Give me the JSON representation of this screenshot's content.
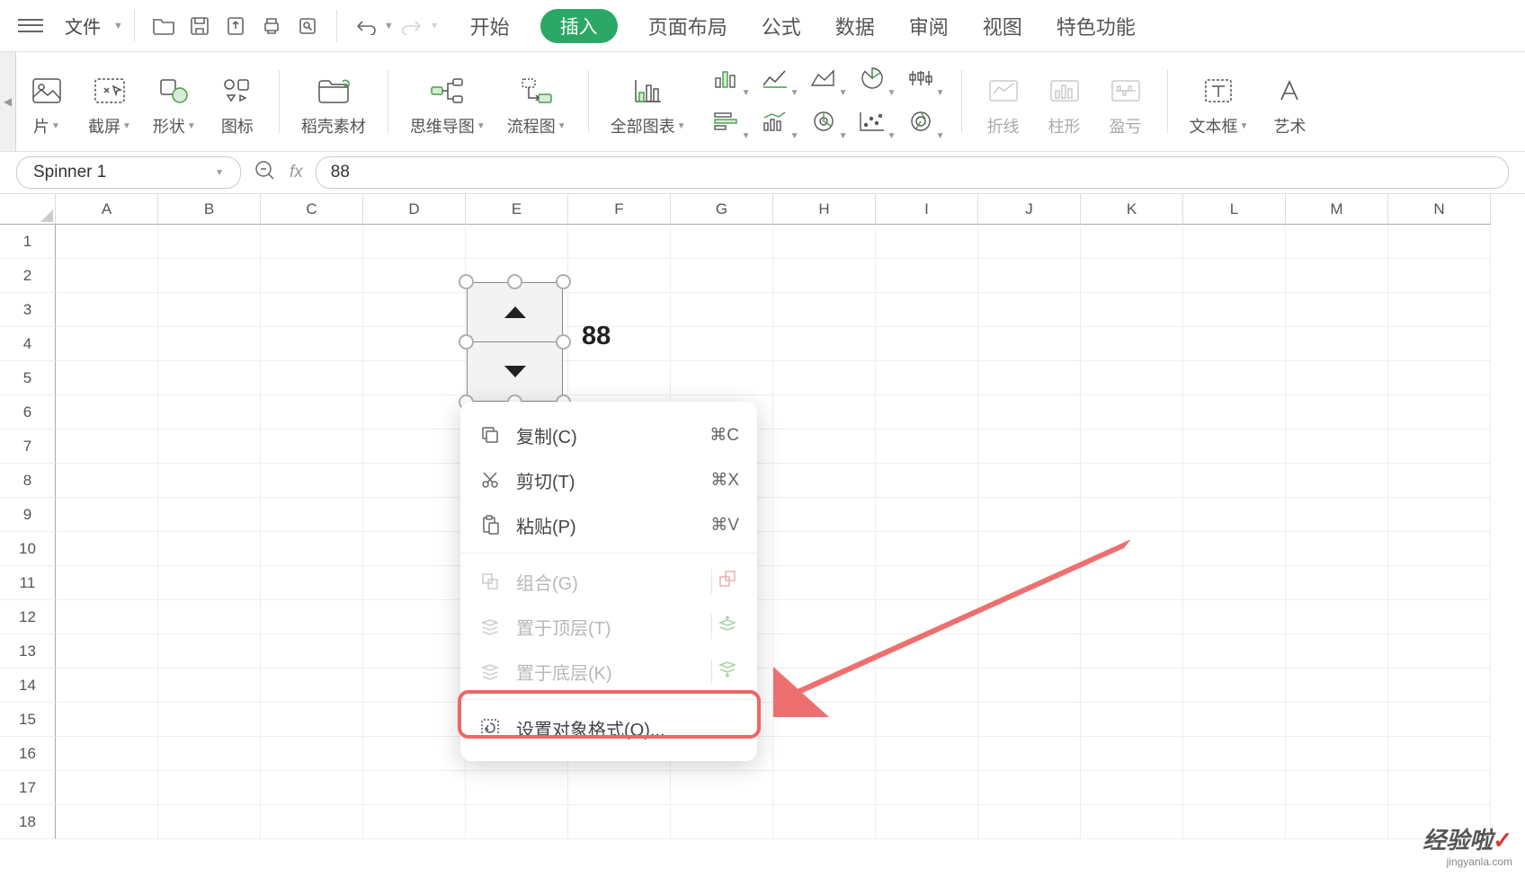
{
  "menubar": {
    "file": "文件"
  },
  "tabs": {
    "start": "开始",
    "insert": "插入",
    "pageLayout": "页面布局",
    "formula": "公式",
    "data": "数据",
    "review": "审阅",
    "view": "视图",
    "special": "特色功能"
  },
  "ribbon": {
    "picture": "片",
    "screenshot": "截屏",
    "shapes": "形状",
    "icons": "图标",
    "docer": "稻壳素材",
    "mindmap": "思维导图",
    "flowchart": "流程图",
    "allCharts": "全部图表",
    "sparklineLine": "折线",
    "sparklineCol": "柱形",
    "sparklinePL": "盈亏",
    "textbox": "文本框",
    "wordart": "艺术"
  },
  "fbar": {
    "name": "Spinner 1",
    "fx": "fx",
    "value": "88"
  },
  "columns": [
    "A",
    "B",
    "C",
    "D",
    "E",
    "F",
    "G",
    "H",
    "I",
    "J",
    "K",
    "L",
    "M",
    "N"
  ],
  "rowCount": 18,
  "cellValue": "88",
  "ctx": {
    "copy": "复制(C)",
    "copySc": "⌘C",
    "cut": "剪切(T)",
    "cutSc": "⌘X",
    "paste": "粘贴(P)",
    "pasteSc": "⌘V",
    "group": "组合(G)",
    "bringFront": "置于顶层(T)",
    "sendBack": "置于底层(K)",
    "format": "设置对象格式(O)..."
  },
  "watermark": {
    "main": "经验啦",
    "sub": "jingyanla.com"
  }
}
